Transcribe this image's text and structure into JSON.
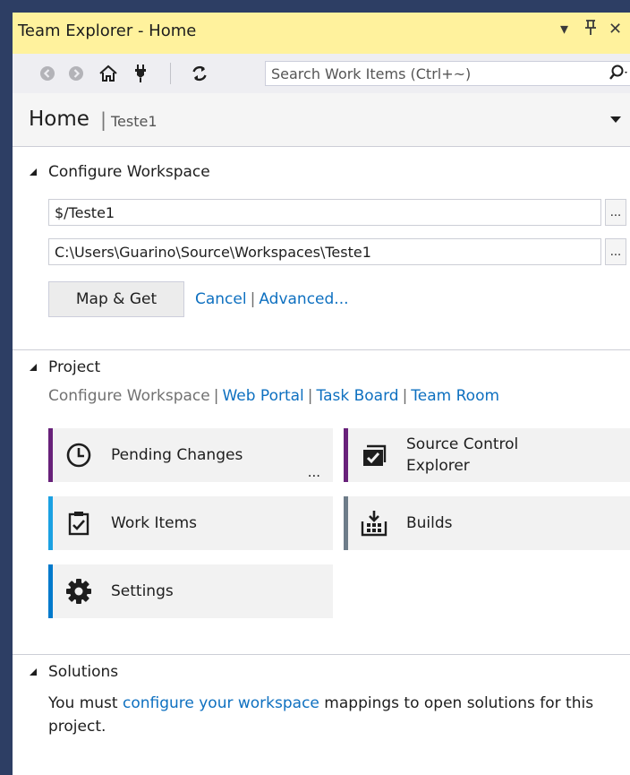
{
  "titlebar": {
    "title": "Team Explorer - Home",
    "dropdown_icon": "▾",
    "pin_icon": "ᚔ",
    "close_icon": "✕"
  },
  "toolbar": {
    "search_placeholder": "Search Work Items (Ctrl+~)"
  },
  "home": {
    "title": "Home",
    "separator": "|",
    "project": "Teste1"
  },
  "configure_workspace": {
    "header": "Configure Workspace",
    "server_path": "$/Teste1",
    "local_path": "C:\\Users\\Guarino\\Source\\Workspaces\\Teste1",
    "browse_label": "...",
    "map_get_label": "Map & Get",
    "cancel_label": "Cancel",
    "separator": "|",
    "advanced_label": "Advanced..."
  },
  "project": {
    "header": "Project",
    "links": [
      {
        "label": "Configure Workspace"
      },
      {
        "label": "Web Portal"
      },
      {
        "label": "Task Board"
      },
      {
        "label": "Team Room"
      }
    ],
    "separator": "|",
    "tiles": [
      {
        "label": "Pending Changes",
        "more": "...",
        "accent": "#68217a"
      },
      {
        "label_line1": "Source Control",
        "label_line2": "Explorer",
        "accent": "#68217a"
      },
      {
        "label": "Work Items",
        "accent": "#1ba1e2"
      },
      {
        "label": "Builds",
        "accent": "#6d7c89"
      },
      {
        "label": "Settings",
        "accent": "#007acc"
      }
    ]
  },
  "solutions": {
    "header": "Solutions",
    "text_before": "You must ",
    "link": "configure your workspace",
    "text_after": " mappings to open solutions for this project."
  },
  "colors": {
    "titlebar_bg": "#fff29d",
    "link": "#0e70c0",
    "frame": "#2d3e64"
  }
}
